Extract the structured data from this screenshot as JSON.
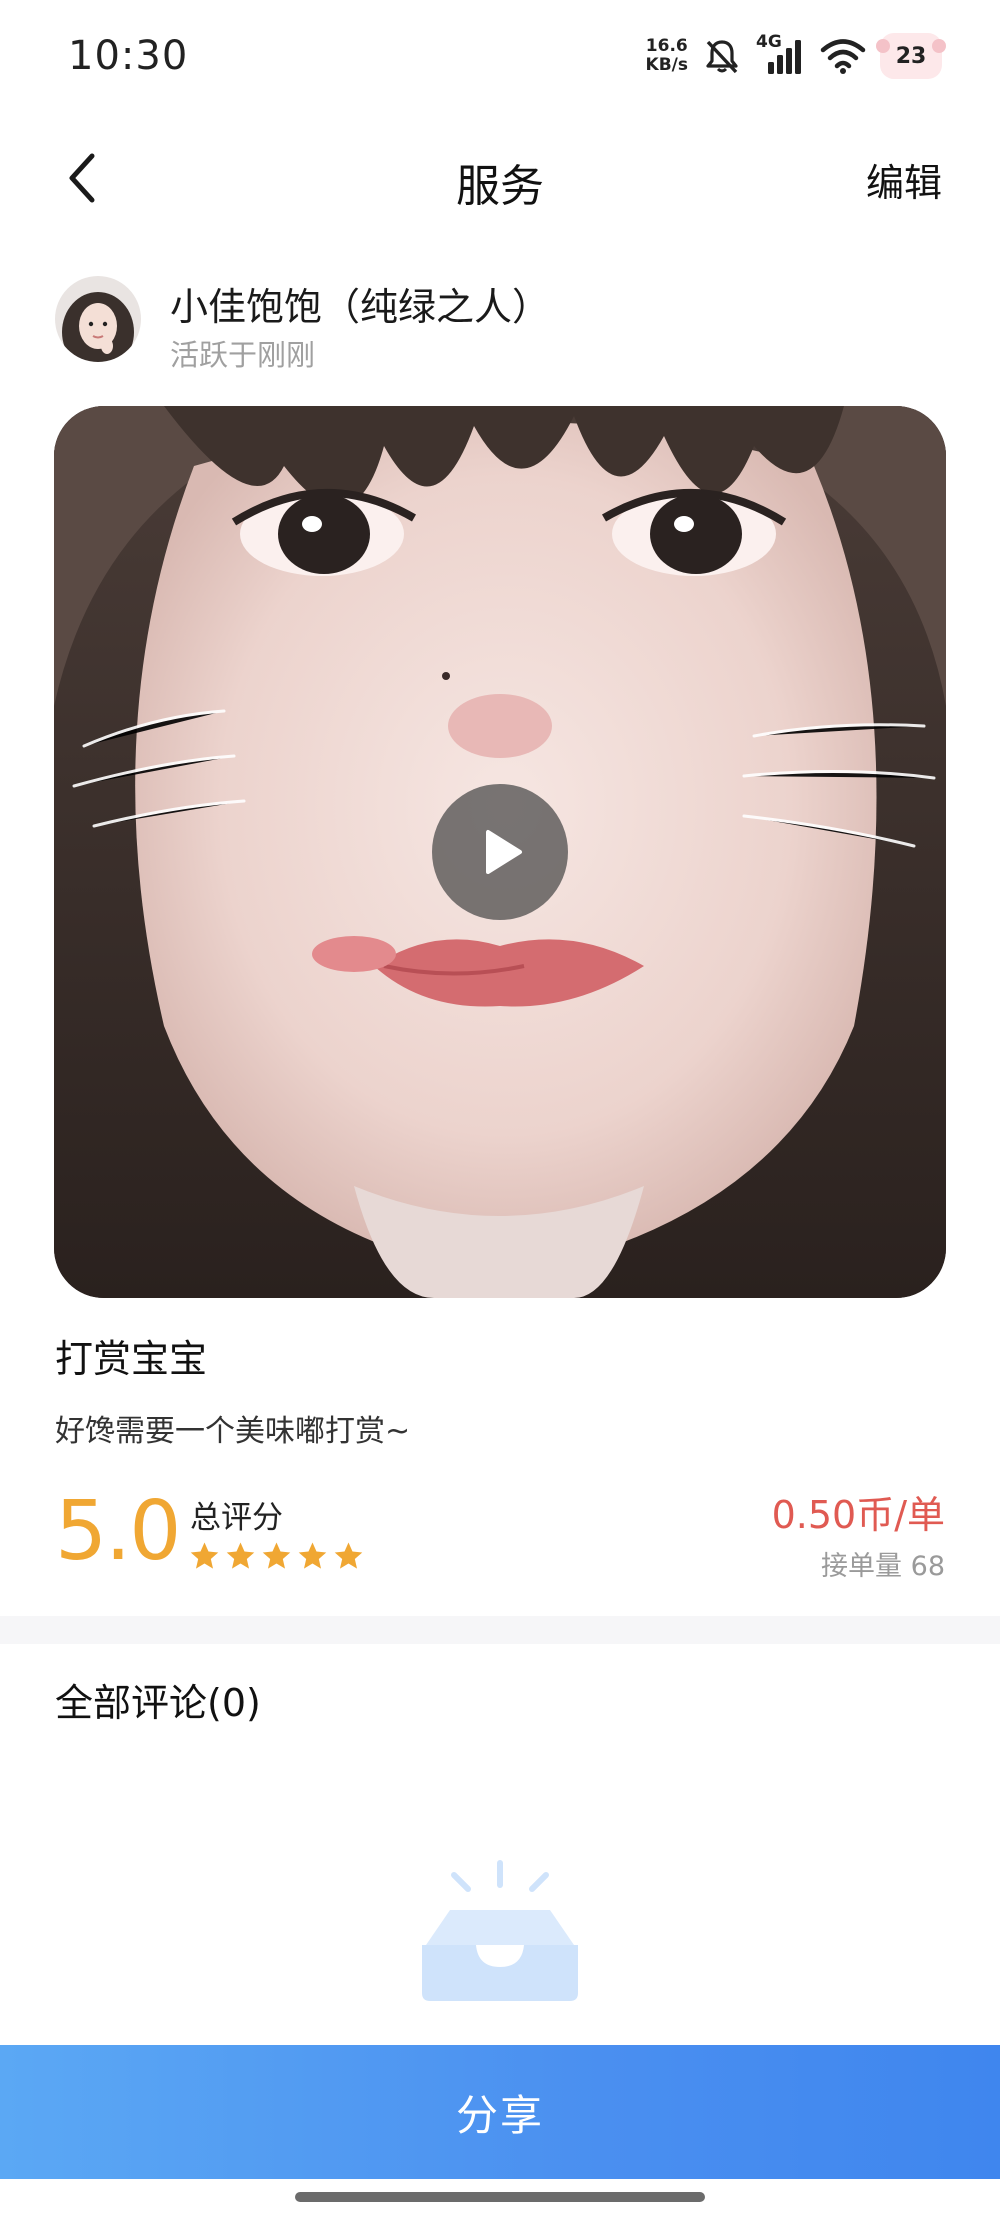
{
  "status_bar": {
    "time": "10:30",
    "net_speed_value": "16.6",
    "net_speed_unit": "KB/s",
    "network_type": "4G",
    "battery": "23"
  },
  "nav": {
    "title": "服务",
    "edit_label": "编辑"
  },
  "user": {
    "name": "小佳饱饱（纯绿之人）",
    "active_status": "活跃于刚刚"
  },
  "service": {
    "title": "打赏宝宝",
    "description": "好馋需要一个美味嘟打赏~",
    "rating": "5.0",
    "rating_label": "总评分",
    "stars": 5,
    "price": "0.50币/单",
    "order_label": "接单量",
    "order_count": "68"
  },
  "comments": {
    "title": "全部评论(0)"
  },
  "share": {
    "label": "分享"
  },
  "colors": {
    "accent_blue": "#4a8ff0",
    "rating_orange": "#f0a733",
    "price_red": "#e05a52",
    "empty_icon_blue": "#cfe3fb"
  }
}
